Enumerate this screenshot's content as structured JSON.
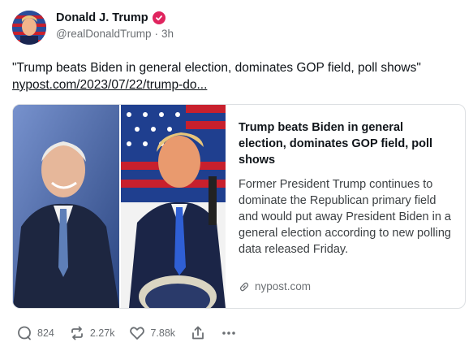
{
  "author": {
    "name": "Donald J. Trump",
    "handle": "@realDonaldTrump",
    "time": "3h",
    "verified_icon": "verified-badge-icon",
    "badge_color": "#e0245e"
  },
  "post": {
    "text": "\"Trump beats Biden in general election, dominates GOP field, poll shows\"",
    "link_text": "nypost.com/2023/07/22/trump-do..."
  },
  "card": {
    "title": "Trump beats Biden in general election, dominates GOP field, poll shows",
    "description": "Former President Trump continues to dominate the Republican primary field and would put away President Biden in a general election according to new polling data released Friday.",
    "domain": "nypost.com",
    "domain_icon": "link-icon"
  },
  "actions": {
    "replies": "824",
    "reposts": "2.27k",
    "likes": "7.88k",
    "share_icon": "share-icon",
    "more_icon": "more-icon"
  }
}
